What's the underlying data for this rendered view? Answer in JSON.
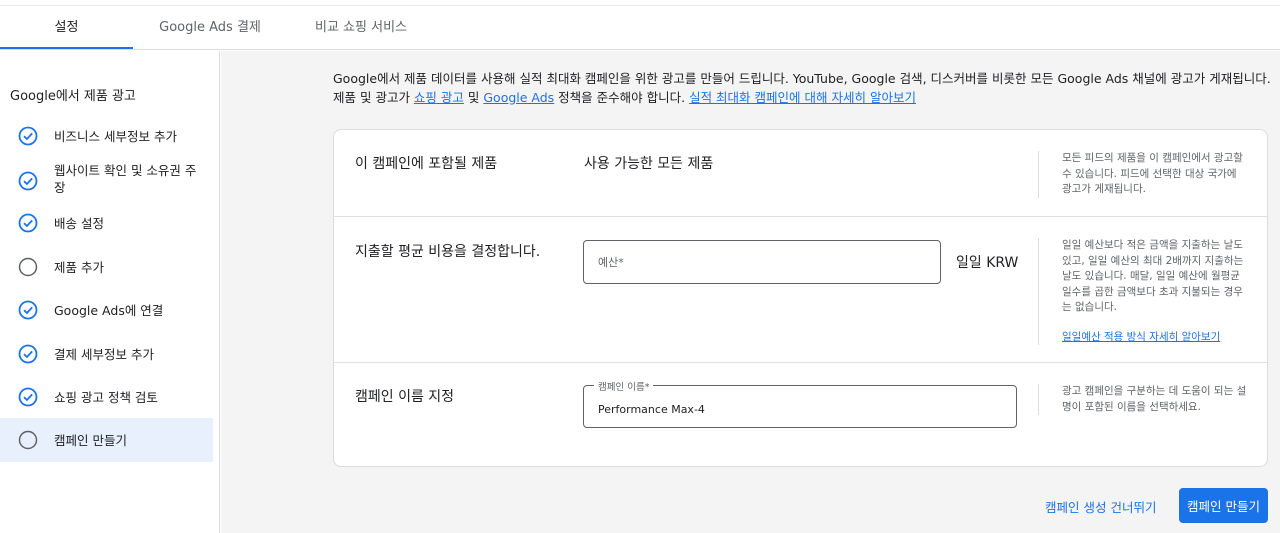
{
  "tabs": [
    {
      "label": "설정"
    },
    {
      "label": "Google Ads 결제"
    },
    {
      "label": "비교 쇼핑 서비스"
    }
  ],
  "sidebar": {
    "title": "Google에서 제품 광고",
    "steps": [
      {
        "label": "비즈니스 세부정보 추가",
        "status": "done"
      },
      {
        "label": "웹사이트 확인 및 소유권 주장",
        "status": "done"
      },
      {
        "label": "배송 설정",
        "status": "done"
      },
      {
        "label": "제품 추가",
        "status": "pending"
      },
      {
        "label": "Google Ads에 연결",
        "status": "done"
      },
      {
        "label": "결제 세부정보 추가",
        "status": "done"
      },
      {
        "label": "쇼핑 광고 정책 검토",
        "status": "done"
      },
      {
        "label": "캠페인 만들기",
        "status": "current"
      }
    ]
  },
  "intro": {
    "line1": "Google에서 제품 데이터를 사용해 실적 최대화 캠페인을 위한 광고를 만들어 드립니다. YouTube, Google 검색, 디스커버를 비롯한 모든 Google Ads 채널에 광고가 게재됩니다.",
    "line2_prefix": "제품 및 광고가 ",
    "link_shopping_ads": "쇼핑 광고",
    "and": " 및 ",
    "link_google_ads": "Google Ads",
    "line2_suffix": " 정책을 준수해야 합니다. ",
    "link_learn_more": "실적 최대화 캠페인에 대해 자세히 알아보기"
  },
  "products_row": {
    "label": "이 캠페인에 포함될 제품",
    "value": "사용 가능한 모든 제품",
    "help": "모든 피드의 제품을 이 캠페인에서 광고할 수 있습니다. 피드에 선택한 대상 국가에 광고가 게재됩니다."
  },
  "budget_row": {
    "label": "지출할 평균 비용을 결정합니다.",
    "placeholder": "예산*",
    "unit": "일일 KRW",
    "help": "일일 예산보다 적은 금액을 지출하는 날도 있고, 일일 예산의 최대 2배까지 지출하는 날도 있습니다. 매달, 일일 예산에 월평균 일수를 곱한 금액보다 초과 지불되는 경우는 없습니다.",
    "help_link": "일일예산 적용 방식 자세히 알아보기"
  },
  "name_row": {
    "label": "캠페인 이름 지정",
    "field_label": "캠페인 이름*",
    "value": "Performance Max-4",
    "help": "광고 캠페인을 구분하는 데 도움이 되는 설명이 포함된 이름을 선택하세요."
  },
  "footer": {
    "skip_label": "캠페인 생성 건너뛰기",
    "create_label": "캠페인 만들기"
  },
  "colors": {
    "accent": "#1a73e8",
    "current_step_bg": "#e8f0fe",
    "pending_icon": "#5f6368"
  }
}
